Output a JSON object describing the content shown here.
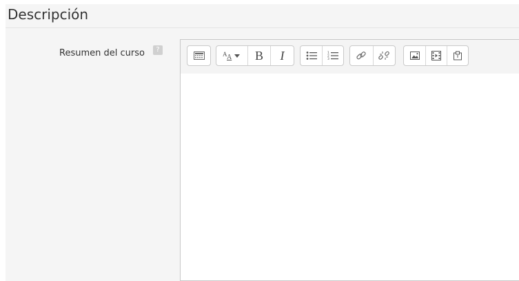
{
  "section": {
    "legend": "Descripción"
  },
  "field": {
    "label": "Resumen del curso",
    "help_icon": "help-icon",
    "content": ""
  },
  "toolbar": {
    "buttons": [
      {
        "name": "toolbar-toggle",
        "icon": "show-more-icon"
      },
      {
        "name": "font-style",
        "icon": "text-style-icon"
      },
      {
        "name": "bold",
        "label": "B"
      },
      {
        "name": "italic",
        "label": "I"
      },
      {
        "name": "unordered-list",
        "icon": "bullet-list-icon"
      },
      {
        "name": "ordered-list",
        "icon": "numbered-list-icon"
      },
      {
        "name": "link",
        "icon": "link-icon"
      },
      {
        "name": "unlink",
        "icon": "unlink-icon"
      },
      {
        "name": "image",
        "icon": "image-icon"
      },
      {
        "name": "media",
        "icon": "media-icon"
      },
      {
        "name": "manage-files",
        "icon": "files-icon"
      }
    ]
  }
}
